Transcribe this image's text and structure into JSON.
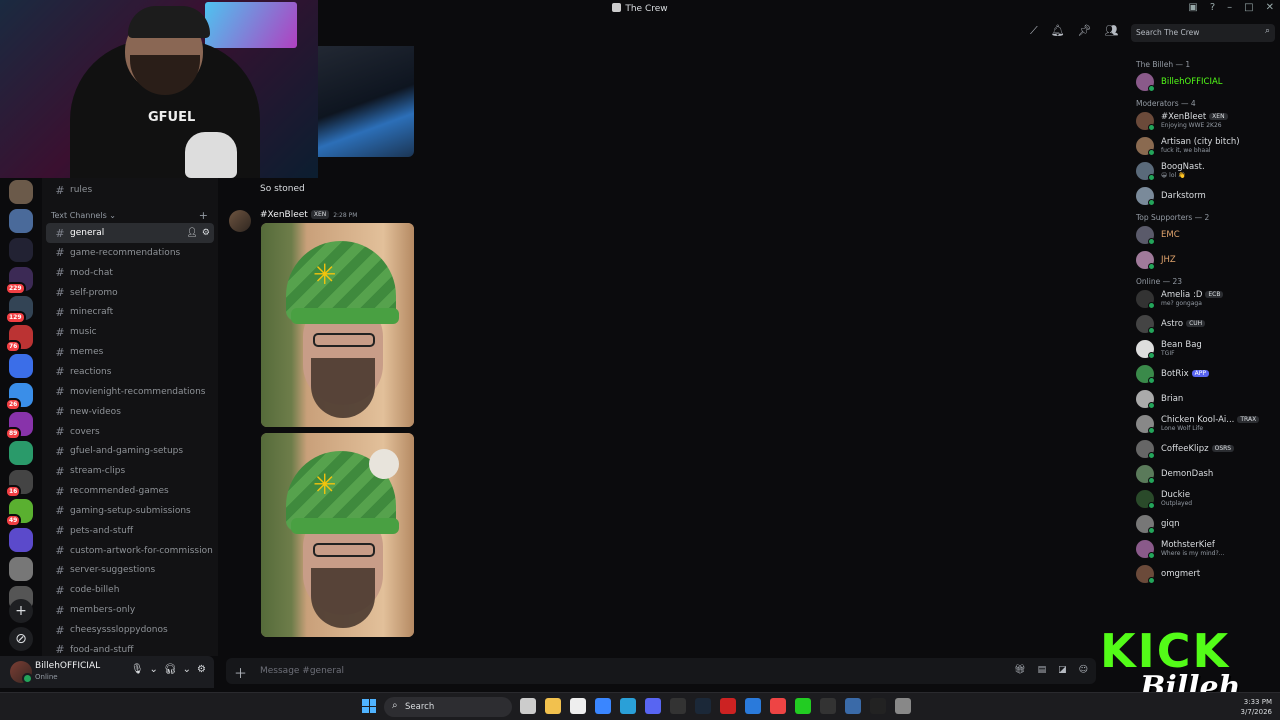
{
  "window": {
    "title": "The Crew"
  },
  "search": {
    "placeholder": "Search The Crew"
  },
  "rail": [
    {
      "badge": ""
    },
    {
      "badge": ""
    },
    {
      "badge": ""
    },
    {
      "badge": "229"
    },
    {
      "badge": "129"
    },
    {
      "badge": "76"
    },
    {
      "badge": ""
    },
    {
      "badge": "26"
    },
    {
      "badge": "89"
    },
    {
      "badge": ""
    },
    {
      "badge": "16"
    },
    {
      "badge": "49"
    },
    {
      "badge": ""
    },
    {
      "badge": ""
    },
    {
      "badge": ""
    }
  ],
  "channels": {
    "top": "rules",
    "category": "Text Channels",
    "items": [
      "general",
      "game-recommendations",
      "mod-chat",
      "self-promo",
      "minecraft",
      "music",
      "memes",
      "reactions",
      "movienight-recommendations",
      "new-videos",
      "covers",
      "gfuel-and-gaming-setups",
      "stream-clips",
      "recommended-games",
      "gaming-setup-submissions",
      "pets-and-stuff",
      "custom-artwork-for-commission",
      "server-suggestions",
      "code-billeh",
      "members-only",
      "cheesysssloppydonos",
      "food-and-stuff"
    ]
  },
  "user": {
    "name": "BillehOFFICIAL",
    "status": "Online"
  },
  "messages": {
    "prev_text": "So stoned",
    "author": "#XenBleet",
    "author_tag": "XEN",
    "time": "2:28 PM"
  },
  "composer": {
    "placeholder": "Message #general"
  },
  "members": {
    "sections": {
      "billeh": "The Billeh — 1",
      "mods": "Moderators — 4",
      "supporters": "Top Supporters — 2",
      "online": "Online — 23"
    },
    "billeh": [
      {
        "name": "BillehOFFICIAL"
      }
    ],
    "mods": [
      {
        "name": "#XenBleet",
        "tag": "XEN",
        "status": "Enjoying WWE 2K26"
      },
      {
        "name": "Artisan (city bitch)",
        "status": "fuck it, we bhaal"
      },
      {
        "name": "BoogNast.",
        "status": "😀 lol 👋"
      },
      {
        "name": "Darkstorm",
        "status": ""
      }
    ],
    "supporters": [
      {
        "name": "EMC"
      },
      {
        "name": "JHZ"
      }
    ],
    "online": [
      {
        "name": "Amelia :D",
        "tag": "ECB",
        "status": "me? gongaga"
      },
      {
        "name": "Astro",
        "tag": "CUH",
        "status": ""
      },
      {
        "name": "Bean Bag",
        "status": "TGIF"
      },
      {
        "name": "BotRix",
        "app": "APP",
        "status": ""
      },
      {
        "name": "Brian",
        "status": ""
      },
      {
        "name": "Chicken Kool-Ai...",
        "tag": "TRAX",
        "status": "Lone Wolf Life"
      },
      {
        "name": "CoffeeKlipz",
        "tag": "OSRS",
        "status": ""
      },
      {
        "name": "DemonDash",
        "status": ""
      },
      {
        "name": "Duckie",
        "status": "Outplayed"
      },
      {
        "name": "giqn",
        "status": ""
      },
      {
        "name": "MothsterKief",
        "status": "Where is my mind?..."
      },
      {
        "name": "omgmert",
        "status": ""
      }
    ]
  },
  "overlay": {
    "kick": "KICK",
    "signature": "Billeh"
  },
  "taskbar": {
    "search": "Search",
    "time": "3:33 PM",
    "date": "3/7/2026"
  },
  "colors": {
    "online": "#23a55a",
    "billeh_name": "#53fc18",
    "role_mod": "#dbdee1",
    "supporter": "#e0a36c",
    "kick_green": "#53fc18"
  }
}
